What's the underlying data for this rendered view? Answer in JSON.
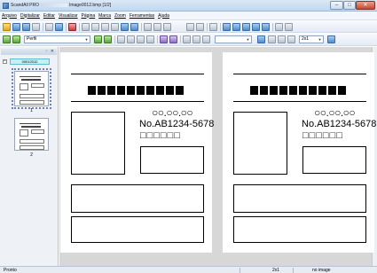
{
  "window": {
    "app_name": "ScandAll PRO",
    "file_name": "Image0012.bmp [1/2]"
  },
  "menu": [
    "Arquivo",
    "Digitalizar",
    "Editar",
    "Visualizar",
    "Página",
    "Marca",
    "Zoom",
    "Ferramentas",
    "Ajuda"
  ],
  "toolbar": {
    "profile_value": "Perfil",
    "zoom_value": "2x1"
  },
  "left_panel": {
    "tree_label": "00012012",
    "thumbnails": [
      {
        "number": "1",
        "selected": true
      },
      {
        "number": "2",
        "selected": false
      }
    ]
  },
  "pages": [
    {
      "circles": "○○.○○.○○",
      "code": "No.AB1234-5678",
      "squares": "□□□□□□"
    },
    {
      "circles": "○○.○○.○○",
      "code": "No.AB1234-5678",
      "squares": "□□□□□□"
    }
  ],
  "status": {
    "ready": "Pronto",
    "layout": "2x1",
    "image_state": "no image"
  },
  "colors": {
    "tree_highlight": "#c6f0f7",
    "view_background": "#d7d7d7"
  }
}
